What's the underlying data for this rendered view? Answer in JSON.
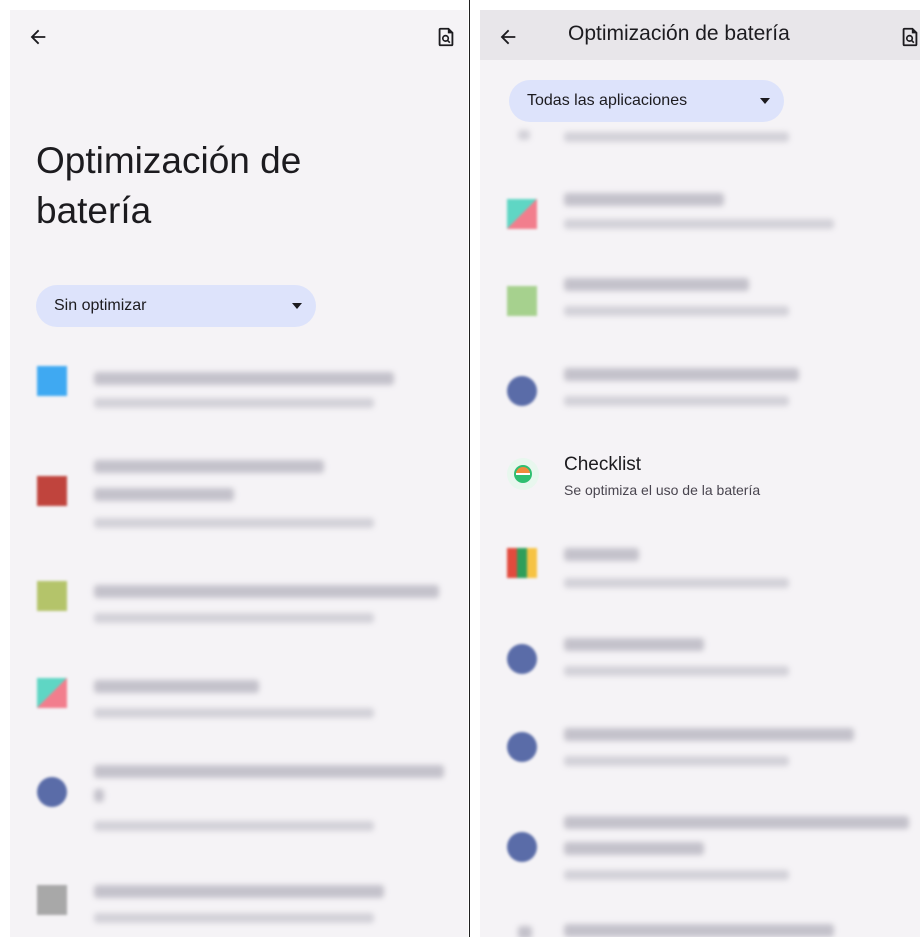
{
  "left_screen": {
    "title": "Optimización de batería",
    "filter": {
      "selected": "Sin optimizar"
    },
    "icons": {
      "back": "arrow-left-icon",
      "search": "search-in-page-icon"
    }
  },
  "right_screen": {
    "title": "Optimización de batería",
    "filter": {
      "selected": "Todas las aplicaciones"
    },
    "icons": {
      "back": "arrow-left-icon",
      "search": "search-in-page-icon"
    },
    "visible_app": {
      "name": "Checklist",
      "status": "Se optimiza el uso de la batería"
    }
  },
  "colors": {
    "background": "#f5f3f6",
    "topbar": "#e8e6ea",
    "chip": "#dde3fb",
    "text": "#1c1b1f"
  }
}
